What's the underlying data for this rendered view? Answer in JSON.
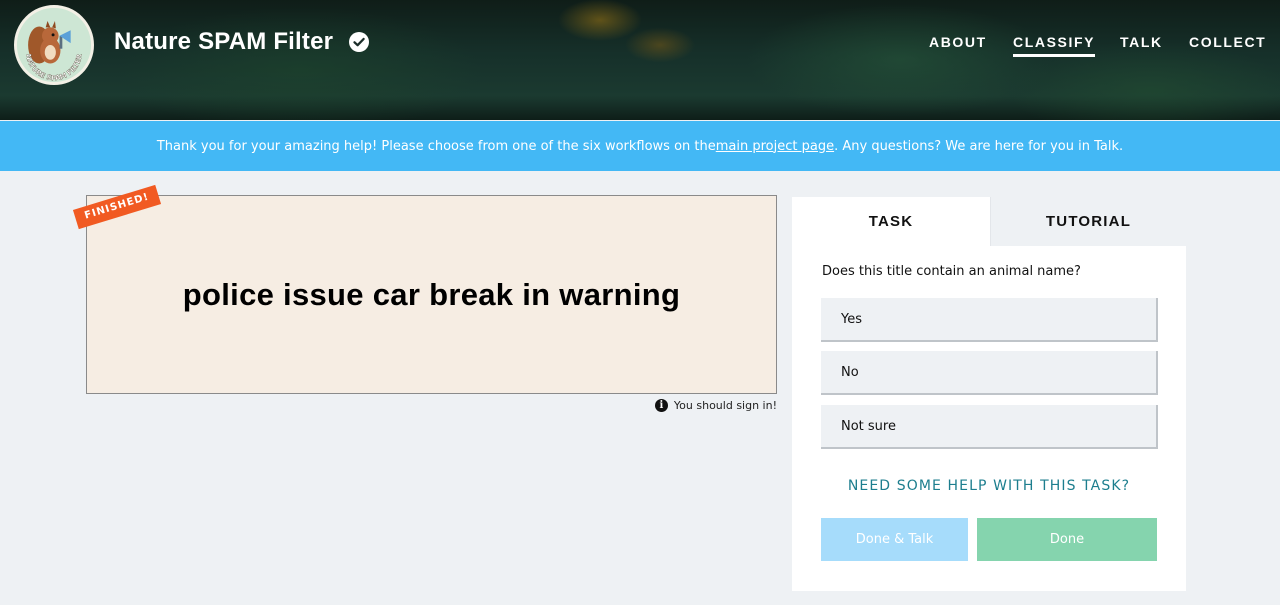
{
  "header": {
    "site_title": "Nature SPAM Filter",
    "logo_text": "NATURE SPAM FILTER",
    "nav": [
      {
        "label": "ABOUT",
        "active": false
      },
      {
        "label": "CLASSIFY",
        "active": true
      },
      {
        "label": "TALK",
        "active": false
      },
      {
        "label": "COLLECT",
        "active": false
      }
    ]
  },
  "banner": {
    "text_before": "Thank you for your amazing help! Please choose from one of the six workflows on the ",
    "link": "main project page",
    "text_after": ". Any questions? We are here for you in Talk."
  },
  "subject": {
    "badge": "FINISHED!",
    "title": "police issue car break in warning",
    "signin_note": "You should sign in!"
  },
  "task_panel": {
    "tabs": [
      "TASK",
      "TUTORIAL"
    ],
    "question": "Does this title contain an animal name?",
    "answers": [
      "Yes",
      "No",
      "Not sure"
    ],
    "help_link": "NEED SOME HELP WITH THIS TASK?",
    "buttons": {
      "done_talk": "Done & Talk",
      "done": "Done"
    }
  },
  "colors": {
    "banner": "#43b8f5",
    "badge": "#f15a22",
    "done_talk_button": "#a6dcfb",
    "done_button": "#85d4ae",
    "help_link": "#1d7e8e"
  }
}
